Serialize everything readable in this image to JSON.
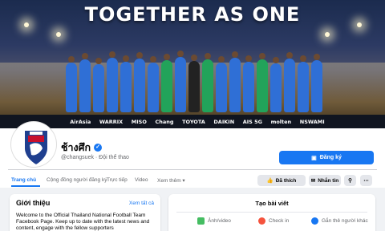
{
  "cover": {
    "title": "TOGETHER AS ONE",
    "sponsors": [
      "AirAsia",
      "WARRIX",
      "MISO",
      "Chang",
      "TOYOTA",
      "DAIKIN",
      "AIS 5G",
      "molten",
      "NSWAMI"
    ]
  },
  "profile": {
    "name": "ช้างศึก",
    "meta": "@changsuek · Đội thể thao",
    "primary_button": "Đăng ký",
    "actions": {
      "like": "Đã thích",
      "message": "Nhắn tin"
    }
  },
  "tabs": [
    "Trang chủ",
    "Cộng đồng người đăng ký",
    "Trực tiếp",
    "Video",
    "Xem thêm ▾"
  ],
  "intro": {
    "title": "Giới thiệu",
    "see_all": "Xem tất cả",
    "text": "Welcome to the Official Thailand National Football Team Facebook Page. Keep up to date with the latest news and content, engage with the fellow supporters"
  },
  "create_post": {
    "title": "Tạo bài viết",
    "options": [
      "Ảnh/video",
      "Check in",
      "Gắn thẻ người khác"
    ]
  },
  "colors": {
    "accent": "#1877f2",
    "bg": "#f0f2f5"
  }
}
